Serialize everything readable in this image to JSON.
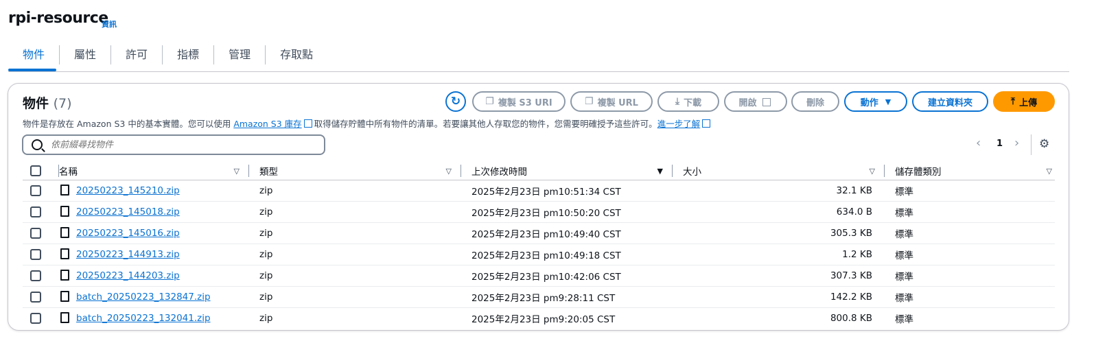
{
  "bucket": {
    "name": "rpi-resource",
    "info_label": "資訊"
  },
  "tabs": [
    {
      "label": "物件",
      "active": true
    },
    {
      "label": "屬性",
      "active": false
    },
    {
      "label": "許可",
      "active": false
    },
    {
      "label": "指標",
      "active": false
    },
    {
      "label": "管理",
      "active": false
    },
    {
      "label": "存取點",
      "active": false
    }
  ],
  "objects_panel": {
    "title": "物件",
    "count": "(7)",
    "description_before": "物件是存放在 Amazon S3 中的基本實體。您可以使用",
    "inventory_link": "Amazon S3 庫存",
    "description_middle": "取得儲存貯體中所有物件的清單。若要讓其他人存取您的物件，您需要明確授予這些許可。",
    "learn_more": "進一步了解",
    "buttons": {
      "copy_s3_uri": "複製 S3 URI",
      "copy_url": "複製 URL",
      "download": "下載",
      "open": "開啟",
      "delete": "刪除",
      "actions": "動作",
      "create_folder": "建立資料夾",
      "upload": "上傳"
    },
    "search_placeholder": "依前綴尋找物件",
    "pagination": {
      "current_page": "1"
    },
    "columns": {
      "name": "名稱",
      "type": "類型",
      "last_modified": "上次修改時間",
      "size": "大小",
      "storage_class": "儲存體類別"
    },
    "rows": [
      {
        "name": "20250223_145210.zip",
        "type": "zip",
        "modified": "2025年2月23日 pm10:51:34 CST",
        "size": "32.1 KB",
        "storage": "標準"
      },
      {
        "name": "20250223_145018.zip",
        "type": "zip",
        "modified": "2025年2月23日 pm10:50:20 CST",
        "size": "634.0 B",
        "storage": "標準"
      },
      {
        "name": "20250223_145016.zip",
        "type": "zip",
        "modified": "2025年2月23日 pm10:49:40 CST",
        "size": "305.3 KB",
        "storage": "標準"
      },
      {
        "name": "20250223_144913.zip",
        "type": "zip",
        "modified": "2025年2月23日 pm10:49:18 CST",
        "size": "1.2 KB",
        "storage": "標準"
      },
      {
        "name": "20250223_144203.zip",
        "type": "zip",
        "modified": "2025年2月23日 pm10:42:06 CST",
        "size": "307.3 KB",
        "storage": "標準"
      },
      {
        "name": "batch_20250223_132847.zip",
        "type": "zip",
        "modified": "2025年2月23日 pm9:28:11 CST",
        "size": "142.2 KB",
        "storage": "標準"
      },
      {
        "name": "batch_20250223_132041.zip",
        "type": "zip",
        "modified": "2025年2月23日 pm9:20:05 CST",
        "size": "800.8 KB",
        "storage": "標準"
      }
    ]
  },
  "colors": {
    "accent": "#0972d3",
    "upload": "#ff9900"
  }
}
